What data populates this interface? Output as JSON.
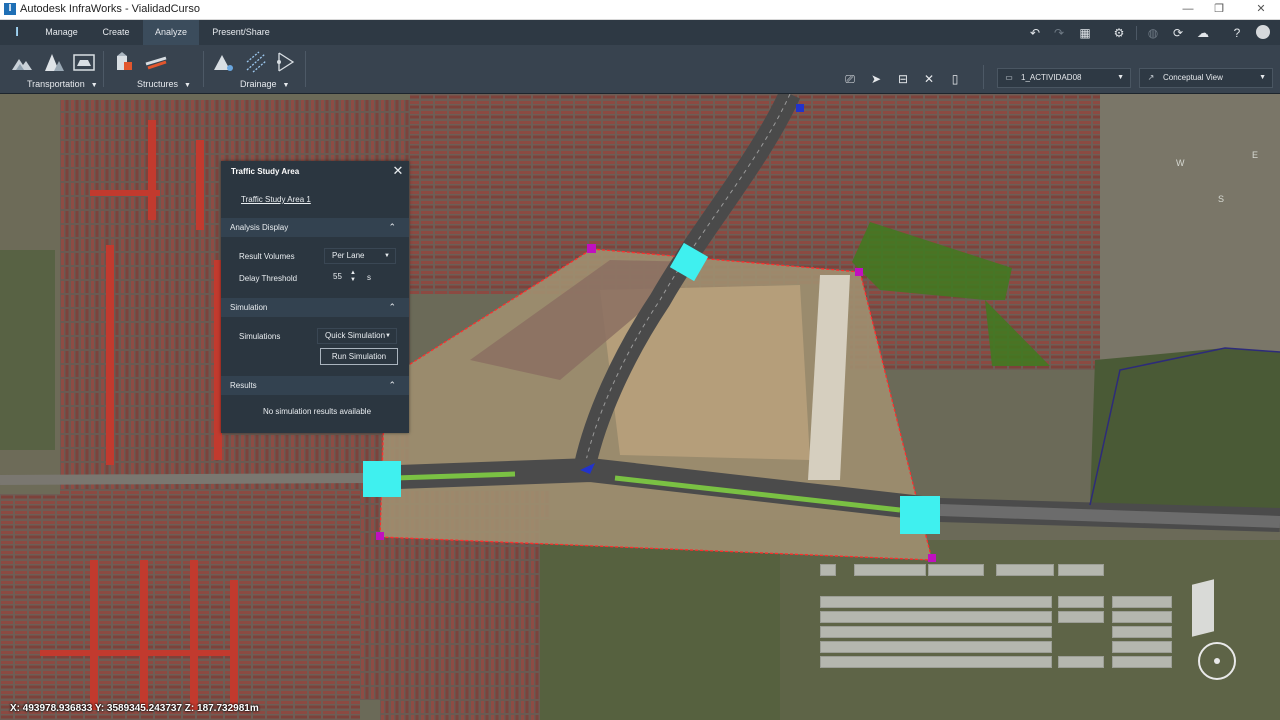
{
  "window": {
    "title": "Autodesk InfraWorks - VialidadCurso",
    "logo_glyph": "I",
    "controls": {
      "minimize": "—",
      "restore": "❐",
      "close": "✕"
    }
  },
  "menu": {
    "logo_glyph": "I",
    "tabs": [
      {
        "label": "Manage",
        "active": false
      },
      {
        "label": "Create",
        "active": false
      },
      {
        "label": "Analyze",
        "active": true
      },
      {
        "label": "Present/Share",
        "active": false
      }
    ],
    "quick_access_icons": [
      "undo-icon",
      "redo-icon",
      "grid-icon",
      "gear-icon",
      "globe-icon",
      "sync-icon",
      "cloud-icon",
      "help-icon",
      "user-icon"
    ]
  },
  "ribbon": {
    "groups": [
      {
        "label": "Transportation",
        "icons": [
          "terrain-icon",
          "mountain-icon",
          "vehicle-icon"
        ]
      },
      {
        "label": "Structures",
        "icons": [
          "structure-icon",
          "bridge-icon"
        ]
      },
      {
        "label": "Drainage",
        "icons": [
          "watershed-icon",
          "network-icon",
          "flow-icon"
        ]
      }
    ],
    "tools": [
      "presentation-icon",
      "select-icon",
      "measure-icon",
      "tools-icon",
      "panel-icon"
    ],
    "proposal": {
      "value": "1_ACTIVIDAD08",
      "icon": "proposal-icon"
    },
    "visual_style": {
      "value": "Conceptual View",
      "icon": "style-icon"
    }
  },
  "panel": {
    "title": "Traffic Study Area",
    "close_glyph": "✕",
    "area_link": "Traffic Study Area 1",
    "sections": {
      "analysis_display": {
        "title": "Analysis Display",
        "result_volumes_label": "Result Volumes",
        "result_volumes_value": "Per Lane",
        "delay_threshold_label": "Delay Threshold",
        "delay_threshold_value": "55",
        "delay_threshold_unit": "s"
      },
      "simulation": {
        "title": "Simulation",
        "simulations_label": "Simulations",
        "simulations_value": "Quick Simulation",
        "run_button": "Run Simulation"
      },
      "results": {
        "title": "Results",
        "message": "No simulation results available"
      }
    }
  },
  "status": {
    "coordinates": "X: 493978.936833 Y: 3589345.243737 Z: 187.732981m"
  },
  "compass": {
    "west": "W",
    "east": "E",
    "south": "S"
  },
  "colors": {
    "study_area_outline": "#ff2d2d",
    "node_marker": "#39f0f0",
    "vertex_marker": "#c010c0",
    "panel_bg": "#2b3640",
    "ribbon_bg": "#38434f"
  }
}
